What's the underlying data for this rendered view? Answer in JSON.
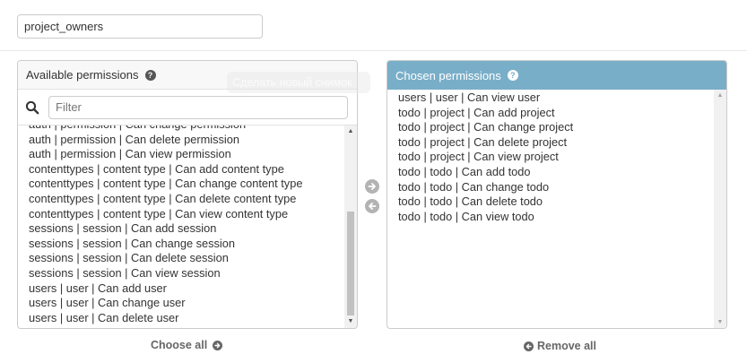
{
  "name_field": {
    "value": "project_owners"
  },
  "available": {
    "title": "Available permissions",
    "filter_placeholder": "Filter",
    "options": [
      "auth | permission | Can change permission",
      "auth | permission | Can delete permission",
      "auth | permission | Can view permission",
      "contenttypes | content type | Can add content type",
      "contenttypes | content type | Can change content type",
      "contenttypes | content type | Can delete content type",
      "contenttypes | content type | Can view content type",
      "sessions | session | Can add session",
      "sessions | session | Can change session",
      "sessions | session | Can delete session",
      "sessions | session | Can view session",
      "users | user | Can add user",
      "users | user | Can change user",
      "users | user | Can delete user"
    ],
    "choose_all": "Choose all"
  },
  "chosen": {
    "title": "Chosen permissions",
    "options": [
      "users | user | Can view user",
      "todo | project | Can add project",
      "todo | project | Can change project",
      "todo | project | Can delete project",
      "todo | project | Can view project",
      "todo | todo | Can add todo",
      "todo | todo | Can change todo",
      "todo | todo | Can delete todo",
      "todo | todo | Can view todo"
    ],
    "remove_all": "Remove all"
  },
  "tooltip": {
    "text": "Сделать новый снимок"
  },
  "icons": {
    "help": "question-circle-icon",
    "filter": "search-icon",
    "add": "arrow-right-circle-icon",
    "remove": "arrow-left-circle-icon"
  },
  "colors": {
    "chosen_header": "#79aec8",
    "available_header": "#f8f8f8"
  }
}
